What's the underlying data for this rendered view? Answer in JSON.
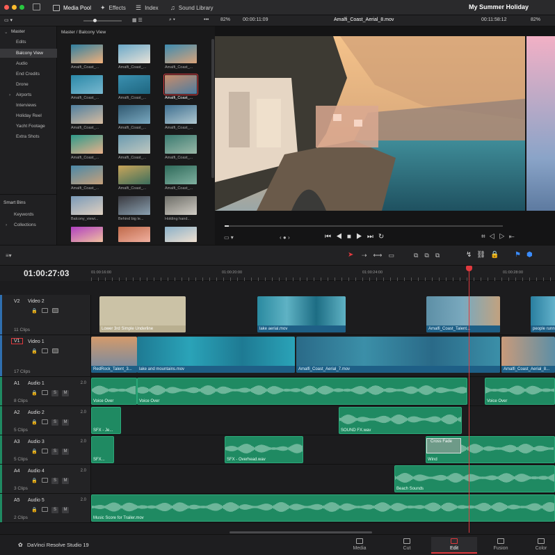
{
  "topbar": {
    "media_pool": "Media Pool",
    "effects": "Effects",
    "index": "Index",
    "sound_library": "Sound Library",
    "project_title": "My Summer Holiday"
  },
  "toolbar2": {
    "zoom_left": "82%",
    "timecode_left": "00:00:11:09",
    "clip_name": "Amalfi_Coast_Aerial_8.mov",
    "timecode_right": "00:11:58:12",
    "zoom_right": "82%"
  },
  "bins": {
    "master": "Master",
    "items": [
      "Edits",
      "Balcony View",
      "Audio",
      "End Credits",
      "Drone",
      "Airports",
      "Interviews",
      "Holiday Reel",
      "Yacht Footage",
      "Extra Shots"
    ],
    "selected": "Balcony View",
    "smart_bins": "Smart Bins",
    "smart_items": [
      "Keywords",
      "Collections"
    ]
  },
  "media_pool": {
    "breadcrumb": "Master / Balcony View",
    "captions": [
      "Amalfi_Coast_...",
      "Amalfi_Coast_...",
      "Amalfi_Coast_...",
      "Amalfi_Coast_...",
      "Amalfi_Coast_...",
      "Amalfi_Coast_...",
      "Amalfi_Coast_...",
      "Amalfi_Coast_...",
      "Amalfi_Coast_...",
      "Amalfi_Coast_...",
      "Amalfi_Coast_...",
      "Amalfi_Coast_...",
      "Amalfi_Coast_...",
      "Amalfi_Coast_...",
      "Amalfi_Coast_...",
      "Balcony_viewi...",
      "Behind big le...",
      "Holding hand...",
      "",
      "",
      ""
    ]
  },
  "timeline": {
    "timecode": "01:00:27:03",
    "ruler": [
      "01:00:16:00",
      "01:00:20:00",
      "01:00:24:00",
      "01:00:28:00"
    ],
    "tracks": [
      {
        "id": "V2",
        "name": "Video 2",
        "clips": "11 Clips"
      },
      {
        "id": "V1",
        "name": "Video 1",
        "clips": "17 Clips"
      },
      {
        "id": "A1",
        "name": "Audio 1",
        "clips": "8 Clips",
        "level": "2.0"
      },
      {
        "id": "A2",
        "name": "Audio 2",
        "clips": "5 Clips",
        "level": "2.0"
      },
      {
        "id": "A3",
        "name": "Audio 3",
        "clips": "5 Clips",
        "level": "2.0"
      },
      {
        "id": "A4",
        "name": "Audio 4",
        "clips": "3 Clips",
        "level": "2.0"
      },
      {
        "id": "A5",
        "name": "Audio 5",
        "clips": "2 Clips",
        "level": "2.0"
      }
    ],
    "v2_clips": [
      "Lower 3rd Simple Underline",
      "lake aerial.mov",
      "Amalfi_Coast_Talent...",
      "people runn..."
    ],
    "v1_clips": [
      "RedRock_Talent_3...",
      "lake and mountains.mov",
      "Amalfi_Coast_Aerial_7.mov",
      "Amalfi_Coast_Aerial_8..."
    ],
    "a1_clips": [
      "Voice Over",
      "Voice Over",
      "Voice Over"
    ],
    "a2_clips": [
      "SFX - Je...",
      "SOUND FX.wav"
    ],
    "a3_clips": [
      "SFX...",
      "SFX - Overhead.wav",
      "Cross Fade",
      "Wind"
    ],
    "a4_clips": [
      "Beach Sounds"
    ],
    "a5_clips": [
      "Music Score for Trailer.mov"
    ]
  },
  "pagebar": {
    "brand": "DaVinci Resolve Studio 19",
    "pages": [
      "Media",
      "Cut",
      "Edit",
      "Fusion",
      "Color"
    ],
    "active": "Edit"
  },
  "colors": {
    "video_clip": "#1f6f92",
    "audio_clip": "#1f8a62",
    "playhead": "#e0393e"
  }
}
